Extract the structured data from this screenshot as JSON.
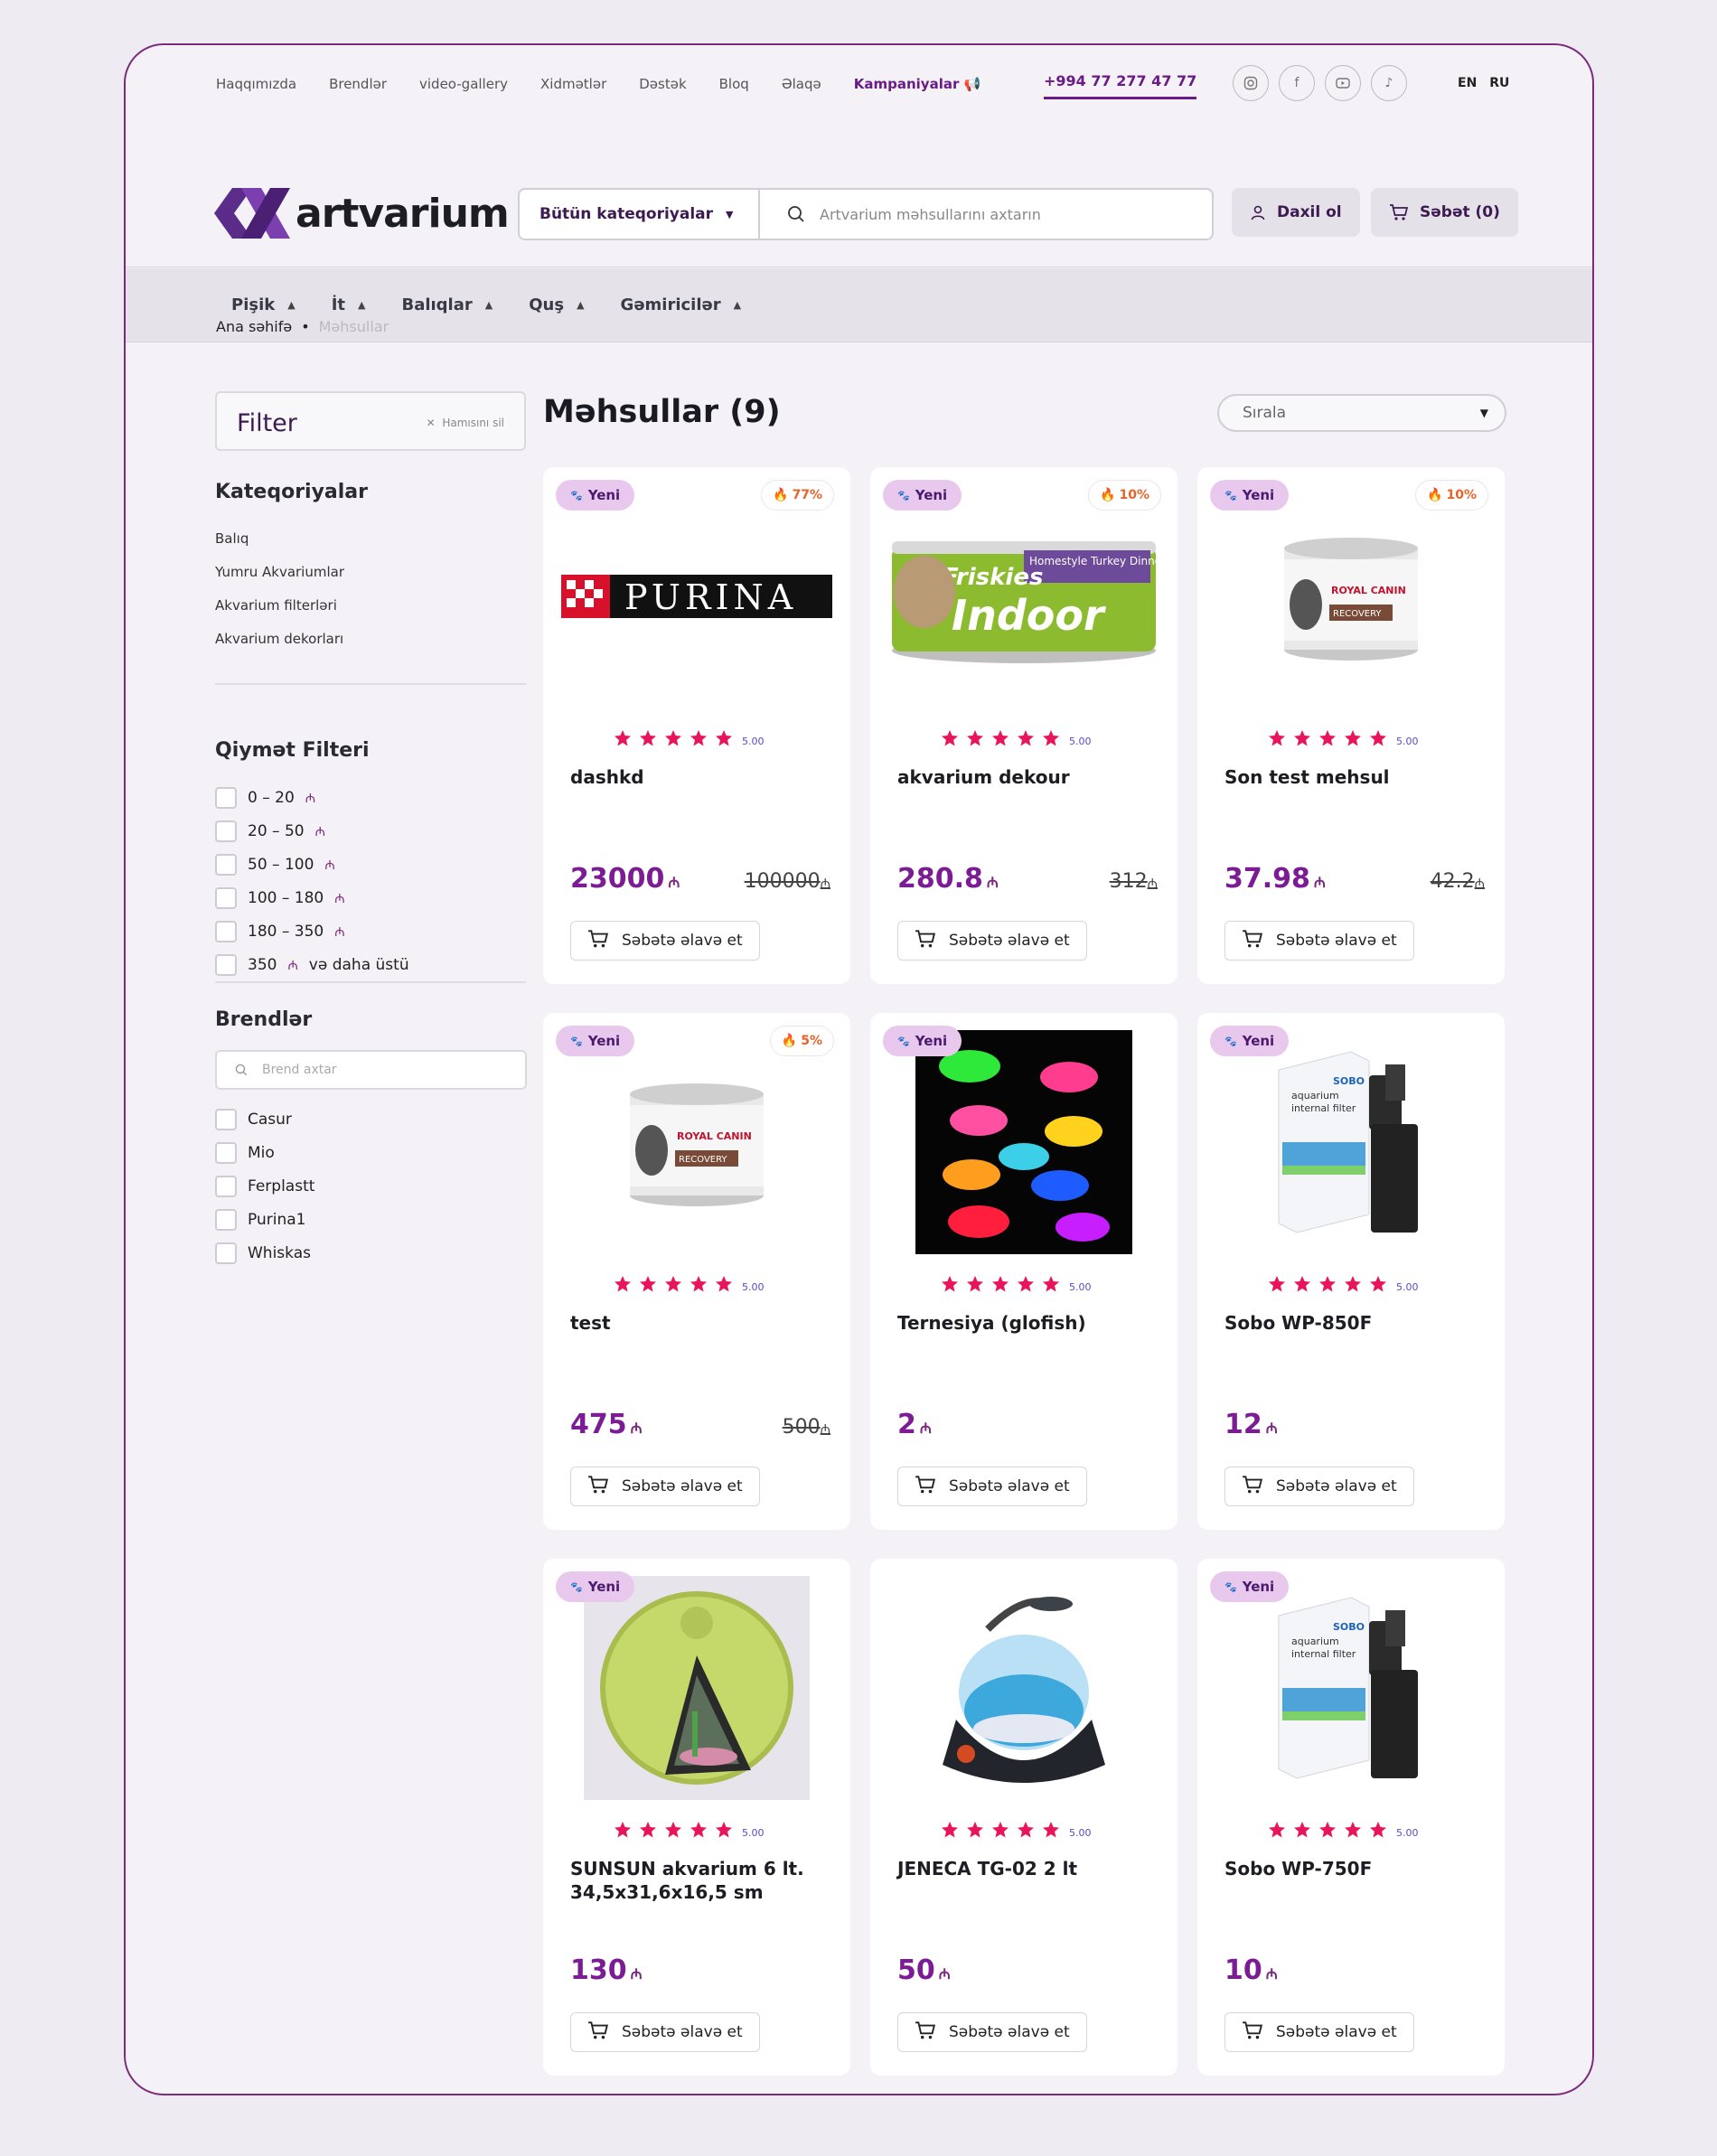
{
  "topbar": {
    "links": [
      "Haqqımızda",
      "Brendlər",
      "video-gallery",
      "Xidmətlər",
      "Dəstək",
      "Bloq",
      "Əlaqə"
    ],
    "campaign": "Kampaniyalar",
    "phone": "+994 77 277 47 77",
    "langs": [
      "EN",
      "RU"
    ]
  },
  "header": {
    "logo_text": "artvarium",
    "category_select": "Bütün kateqoriyalar",
    "search_placeholder": "Artvarium məhsullarını axtarın",
    "login": "Daxil ol",
    "cart": "Səbət (0)"
  },
  "nav": [
    "Pişik",
    "İt",
    "Balıqlar",
    "Quş",
    "Gəmiricilər"
  ],
  "breadcrumb": {
    "home": "Ana səhifə",
    "current": "Məhsullar"
  },
  "filter": {
    "title": "Filter",
    "clear": "Hamısını sil",
    "categories_title": "Kateqoriyalar",
    "categories": [
      "Balıq",
      "Yumru Akvariumlar",
      "Akvarium filterləri",
      "Akvarium dekorları"
    ],
    "price_title": "Qiymət Filteri",
    "prices": [
      "0 – 20",
      "20 – 50",
      "50 – 100",
      "100 – 180",
      "180 – 350",
      "350"
    ],
    "price_more": "və daha üstü",
    "currency": "₼",
    "brands_title": "Brendlər",
    "brand_search": "Brend axtar",
    "brands": [
      "Casur",
      "Mio",
      "Ferplastt",
      "Purina1",
      "Whiskas"
    ]
  },
  "products_title": "Məhsullar (9)",
  "sort_label": "Sırala",
  "new_label": "Yeni",
  "add_to_cart": "Səbətə əlavə et",
  "rating_label": "5.00",
  "products": [
    {
      "name": "dashkd",
      "price": "23000",
      "old": "100000",
      "disc": "77%",
      "img": "purina"
    },
    {
      "name": "akvarium dekour",
      "price": "280.8",
      "old": "312",
      "disc": "10%",
      "img": "friskies"
    },
    {
      "name": "Son test mehsul",
      "price": "37.98",
      "old": "42.2",
      "disc": "10%",
      "img": "can"
    },
    {
      "name": "test",
      "price": "475",
      "old": "500",
      "disc": "5%",
      "img": "can"
    },
    {
      "name": "Ternesiya (glofish)",
      "price": "2",
      "old": "",
      "disc": "",
      "img": "fish"
    },
    {
      "name": "Sobo WP-850F",
      "price": "12",
      "old": "",
      "disc": "",
      "img": "filter"
    },
    {
      "name": "SUNSUN akvarium 6 lt. 34,5x31,6x16,5 sm",
      "price": "130",
      "old": "",
      "disc": "",
      "img": "sunsun"
    },
    {
      "name": "JENECA TG-02 2 lt",
      "price": "50",
      "old": "",
      "disc": "",
      "img": "bowl",
      "nobadge": true
    },
    {
      "name": "Sobo WP-750F",
      "price": "10",
      "old": "",
      "disc": "",
      "img": "filter"
    }
  ]
}
